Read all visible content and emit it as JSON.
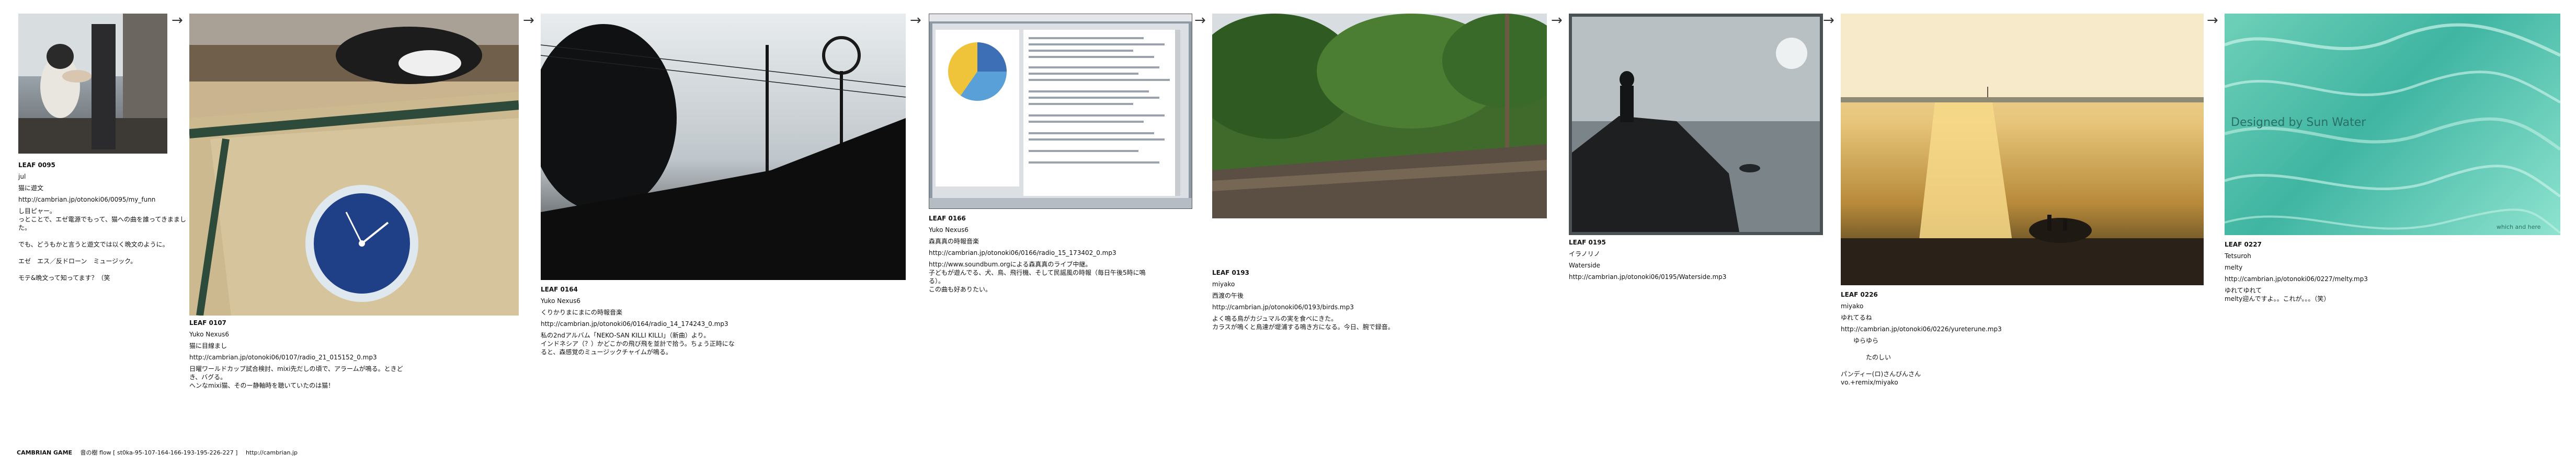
{
  "leaves": [
    {
      "id": "LEAF 0095",
      "author": "jul",
      "title": "猫に遊文",
      "url": "http://cambrian.jp/otonoki06/0095/my_funn",
      "body": "し目ピャー。\nっとことで、エゼ電源でもって、猫への曲を誰ってきまました。\n\nでも、どうもかと言うと遊文では以く晩文のように。\n\nエゼ　エス／反ドローン　ミュージック。\n\nモテ&晩文って知ってます？（笑"
    },
    {
      "id": "LEAF 0107",
      "author": "Yuko Nexus6",
      "title": "猫に目線まし",
      "url": "http://cambrian.jp/otonoki06/0107/radio_21_015152_0.mp3",
      "body": "日曜ワールドカップ試合検討、mixi先だしの頃で、アラームが鳴る。ときどき、バグる。\nへンなmixi猫、そのー静軸時を聴いていたのは猫！"
    },
    {
      "id": "LEAF 0164",
      "author": "Yuko Nexus6",
      "title": "くりかりまにまにの時報音楽",
      "url": "http://cambrian.jp/otonoki06/0164/radio_14_174243_0.mp3",
      "body": "私の2ndアルバム「NEKO-SAN KILLI KILLI」（新曲）より。\nインドネシア（？）かどこかの飛び飛を並計で拾う。ちょう正時になると、森感覚のミュージックチャイムが鳴る。"
    },
    {
      "id": "LEAF 0166",
      "author": "Yuko Nexus6",
      "title": "森真真の時報音楽",
      "url": "http://cambrian.jp/otonoki06/0166/radio_15_173402_0.mp3",
      "body": "http://www.soundbum.orgによる森真真のライブ中継。\n子どもが遊んでる、犬、鳥、飛行機、そして民謡風の時報（毎日午後5時に鳴る）。\nこの曲も好ありたい。"
    },
    {
      "id": "LEAF 0193",
      "author": "miyako",
      "title": "西渡の午後",
      "url": "http://cambrian.jp/otonoki06/0193/birds.mp3",
      "body": "よく鳴る鳥がカジュマルの実を食べにきた。\nカラスが鳴くと鳥達が堤浦する鳴き方になる。今日、腕で録音。"
    },
    {
      "id": "LEAF 0195",
      "author": "イラノリノ",
      "title": "Waterside",
      "url": "http://cambrian.jp/otonoki06/0195/Waterside.mp3",
      "body": ""
    },
    {
      "id": "LEAF 0226",
      "author": "miyako",
      "title": "ゆれてるね",
      "url": "http://cambrian.jp/otonoki06/0226/yureterune.mp3",
      "body": "　　ゆらゆら\n\n　　　　たのしい\n\nパンディー(ロ)さんびんさん\nvo.+remix/miyako"
    },
    {
      "id": "LEAF 0227",
      "author": "Tetsuroh",
      "title": "melty",
      "url": "http://cambrian.jp/otonoki06/0227/melty.mp3",
      "body": "ゆれてゆれて\nmelty迎んですよ。。これが。。。（笑）"
    }
  ],
  "photo_texts": {
    "water_overlay": "Designed by Sun Water",
    "water_credit": "which and here"
  },
  "arrow_glyph": "→",
  "footer": {
    "brand": "CAMBRIAN GAME",
    "title": "音の樹 flow [ st0ka-95-107-164-166-193-195-226-227 ]",
    "link": "http://cambrian.jp"
  }
}
